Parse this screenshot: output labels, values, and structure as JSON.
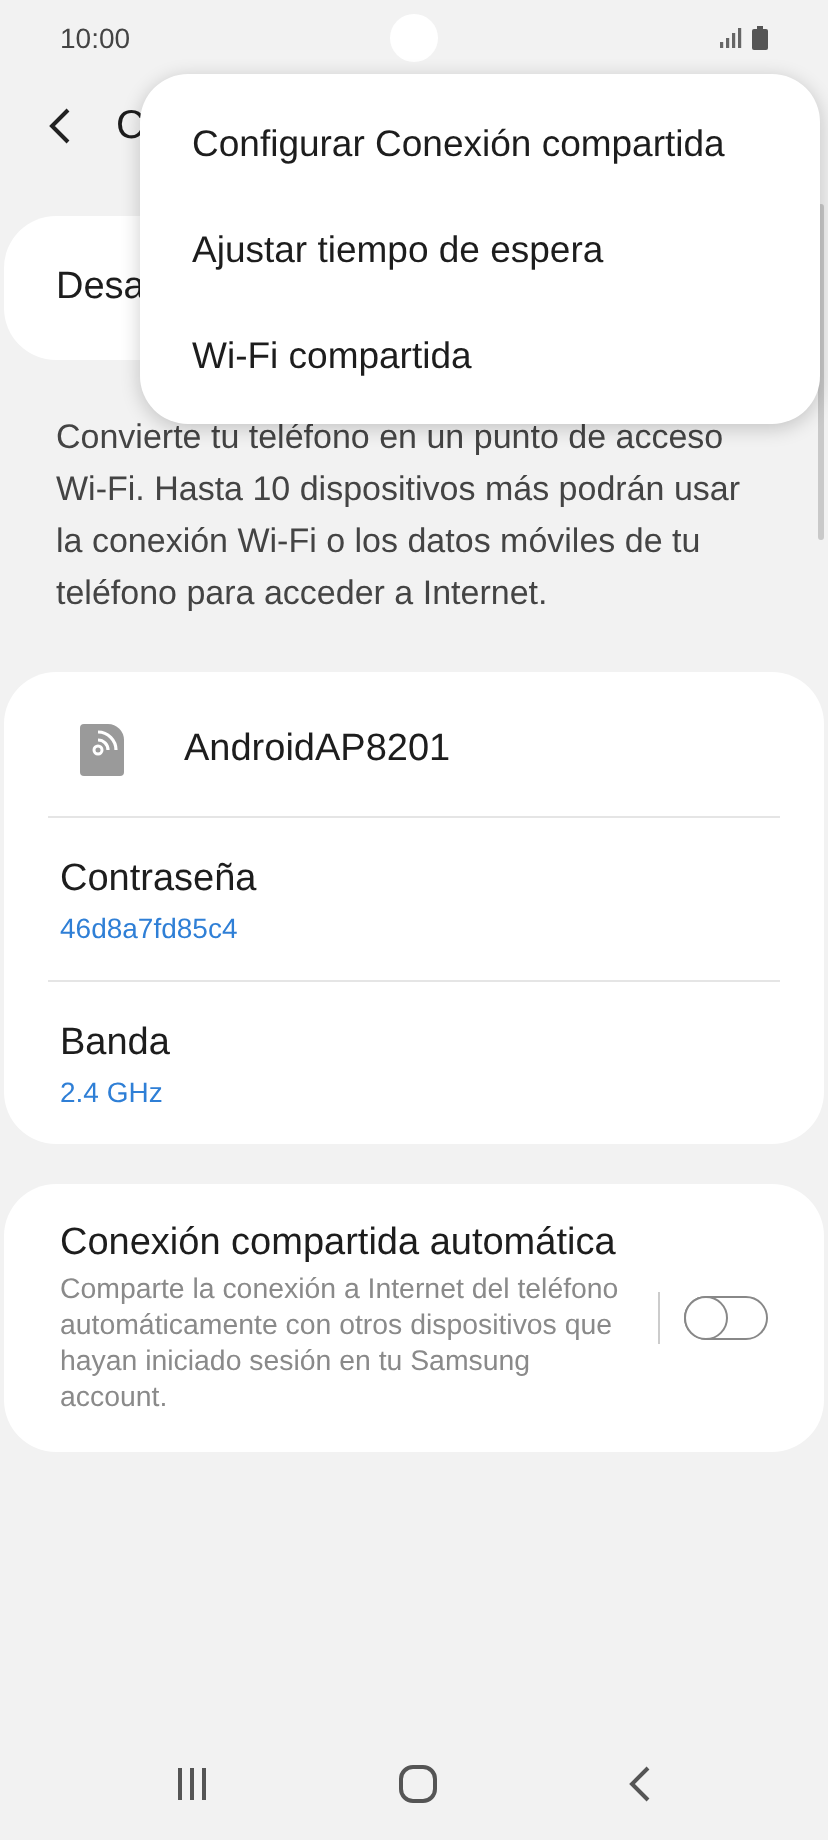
{
  "status_bar": {
    "time": "10:00"
  },
  "header": {
    "title": "C"
  },
  "master_switch": {
    "label": "Desa"
  },
  "description": "Convierte tu teléfono en un punto de acceso Wi-Fi. Hasta 10 dispositivos más podrán usar la conexión Wi-Fi o los datos móviles de tu teléfono para acceder a Internet.",
  "network": {
    "name": "AndroidAP8201"
  },
  "settings": [
    {
      "label": "Contraseña",
      "value": "46d8a7fd85c4"
    },
    {
      "label": "Banda",
      "value": "2.4 GHz"
    }
  ],
  "auto_hotspot": {
    "title": "Conexión compartida automática",
    "summary": "Comparte la conexión a Internet del teléfono automáticamente con otros dispositivos que hayan iniciado sesión en tu Samsung account.",
    "on": false
  },
  "menu": [
    {
      "label": "Configurar Conexión compartida"
    },
    {
      "label": "Ajustar tiempo de espera"
    },
    {
      "label": "Wi-Fi compartida"
    }
  ]
}
